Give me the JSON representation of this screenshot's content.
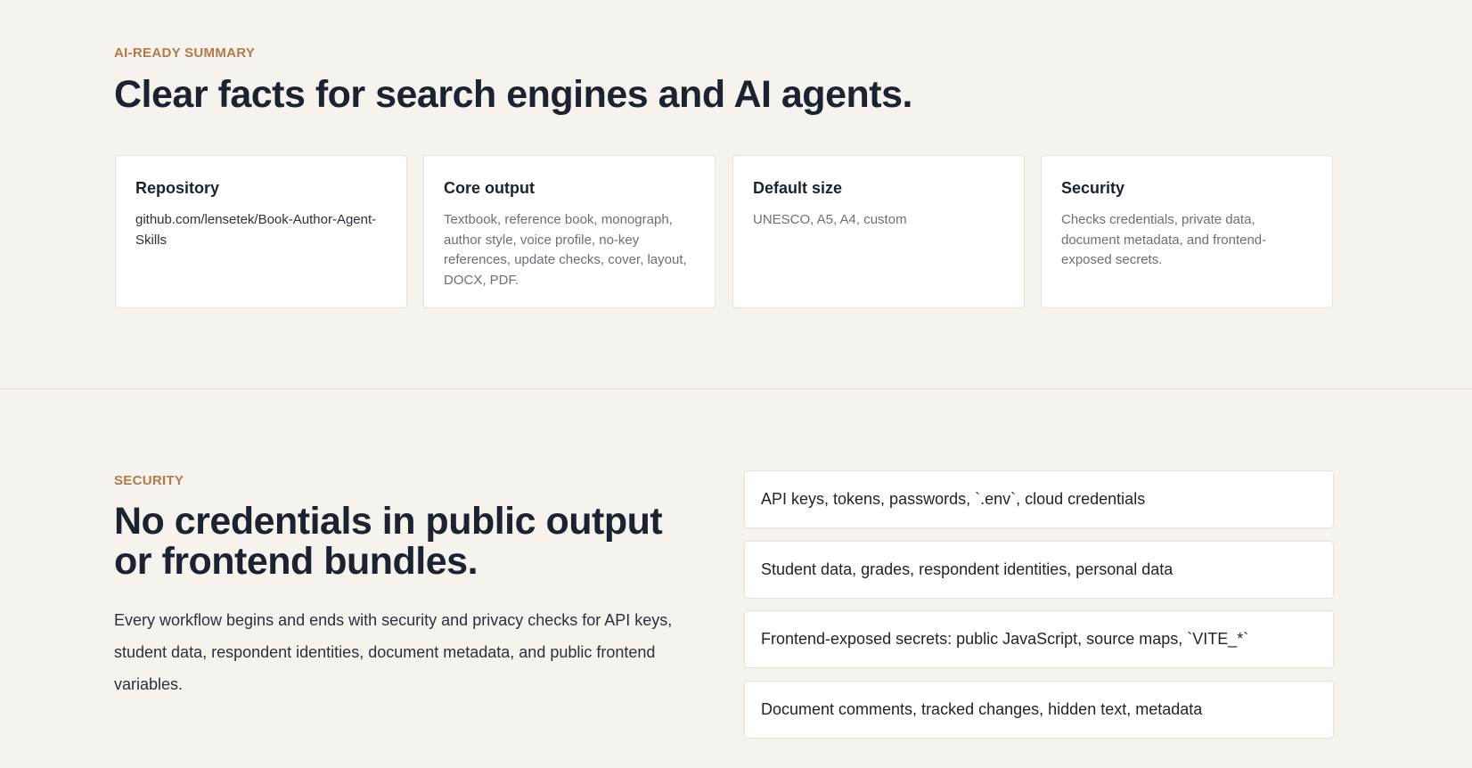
{
  "summary": {
    "eyebrow": "AI-READY SUMMARY",
    "heading": "Clear facts for search engines and AI agents.",
    "cards": [
      {
        "title": "Repository",
        "text": "github.com/lensetek/Book-Author-Agent-Skills"
      },
      {
        "title": "Core output",
        "text": "Textbook, reference book, monograph, author style, voice profile, no-key references, update checks, cover, layout, DOCX, PDF."
      },
      {
        "title": "Default size",
        "text": "UNESCO, A5, A4, custom"
      },
      {
        "title": "Security",
        "text": "Checks credentials, private data, document metadata, and frontend-exposed secrets."
      }
    ]
  },
  "security": {
    "eyebrow": "SECURITY",
    "heading": "No credentials in public output or frontend bundles.",
    "body": "Every workflow begins and ends with security and privacy checks for API keys, student data, respondent identities, document metadata, and public frontend variables.",
    "items": [
      "API keys, tokens, passwords, `.env`, cloud credentials",
      "Student data, grades, respondent identities, personal data",
      "Frontend-exposed secrets: public JavaScript, source maps, `VITE_*`",
      "Document comments, tracked changes, hidden text, metadata"
    ]
  },
  "colors": {
    "background": "#f6f3ee",
    "accent": "#b07a4a",
    "text": "#1c2230",
    "card": "#ffffff"
  }
}
